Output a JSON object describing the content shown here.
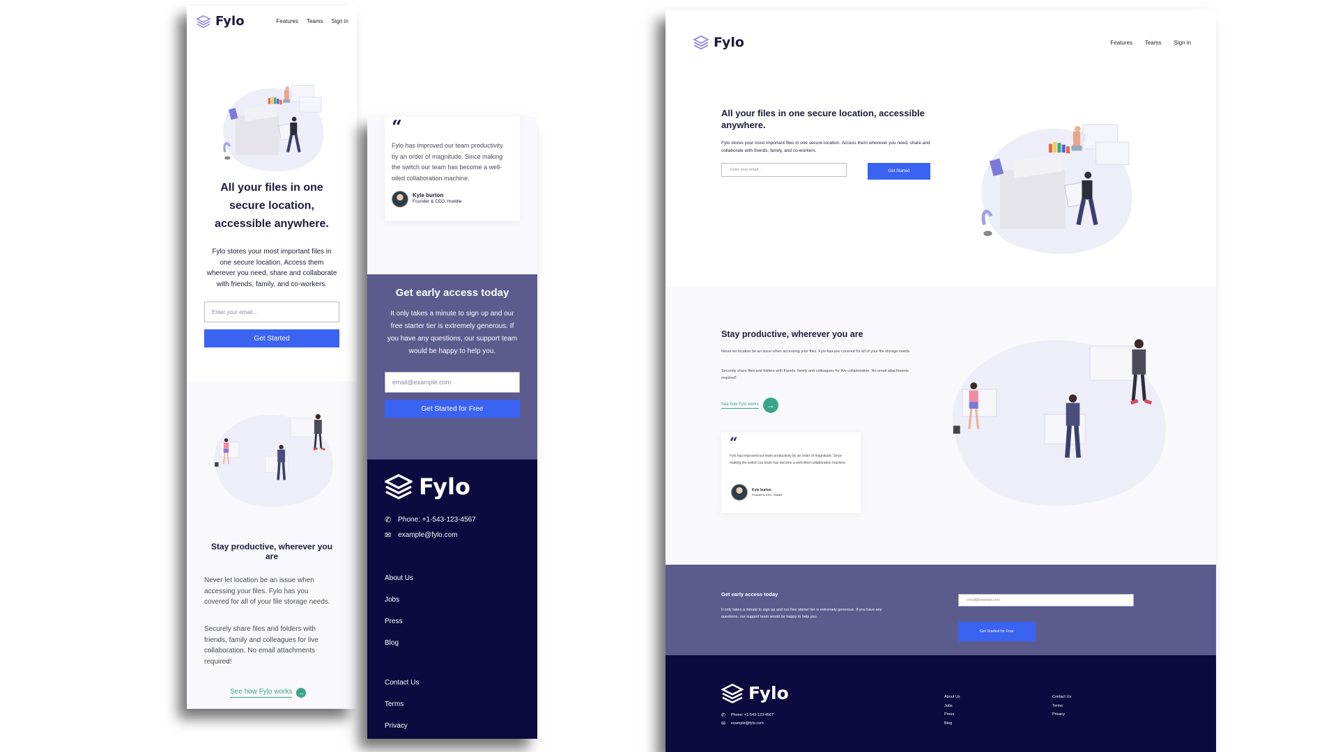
{
  "brand": {
    "name": "Fylo"
  },
  "nav": {
    "features": "Features",
    "teams": "Teams",
    "signin": "Sign in"
  },
  "hero": {
    "title": "All your files in one secure location, accessible anywhere.",
    "mobile_title_lines": [
      "All your files in one",
      "secure location,",
      "accessible anywhere."
    ],
    "body": "Fylo stores your most important files in one secure location. Access them wherever you need, share and collaborate with friends, family, and co-workers.",
    "mobile_body_lines": [
      "Fylo stores your most important files in",
      "one secure location. Access them",
      "wherever you need, share and collaborate",
      "with friends, family, and co-workers."
    ],
    "email_placeholder": "Enter your email...",
    "cta": "Get Started"
  },
  "productive": {
    "title": "Stay productive, wherever you are",
    "mobile_title_lines": [
      "Stay productive, wherever you",
      "are"
    ],
    "p1": "Never let location be an issue when accessing your files. Fylo has you covered for all of your file storage needs.",
    "p2": "Securely share files and folders with friends, family and colleagues for live collaboration. No email attachments required!",
    "mobile_p1_lines": [
      "Never let location be an issue when",
      "accessing your files. Fylo has you",
      "covered for all of your file storage needs."
    ],
    "mobile_p2_lines": [
      "Securely share files and folders with",
      "friends, family and colleagues for live",
      "collaboration. No email attachments",
      "required!"
    ],
    "link": "See how Fylo works"
  },
  "testimonial": {
    "quote": "Fylo has improved our team productivity by an order of magnitude. Since making the switch our team has become a well-oiled collaboration machine.",
    "quote_lines": [
      "Fylo has improved our team productivity",
      "by an order of magnitude. Since making",
      "the switch our team has become a well-",
      "oiled collaboration machine."
    ],
    "name": "Kyle burton",
    "role": "Founder & CEO, Huddle"
  },
  "early": {
    "title": "Get early access today",
    "body": "It only takes a minute to sign up and our free starter tier is extremely generous. If you have any questions, our support team would be happy to help you.",
    "mobile_body_lines": [
      "It only takes a minute to sign up and our",
      "free starter tier is extremely generous. If",
      "you have any questions, our support team",
      "would be happy to help you."
    ],
    "email_placeholder": "email@example.com",
    "cta": "Get Started for Free"
  },
  "footer": {
    "phone": "Phone: +1-543-123-4567",
    "email": "example@fylo.com",
    "col1": [
      "About Us",
      "Jobs",
      "Press",
      "Blog"
    ],
    "col2": [
      "Contact Us",
      "Terms",
      "Privacy"
    ]
  },
  "colors": {
    "navy": "#0c0a3e",
    "purple": "#5b5b8e",
    "blue": "#3a63f2",
    "teal": "#3ba58a",
    "soft": "#f8f8fd"
  },
  "icons": {
    "logo": "layers-logo-icon",
    "phone": "phone-icon",
    "email": "email-icon",
    "quote": "quote-icon",
    "arrow": "arrow-right-icon"
  }
}
